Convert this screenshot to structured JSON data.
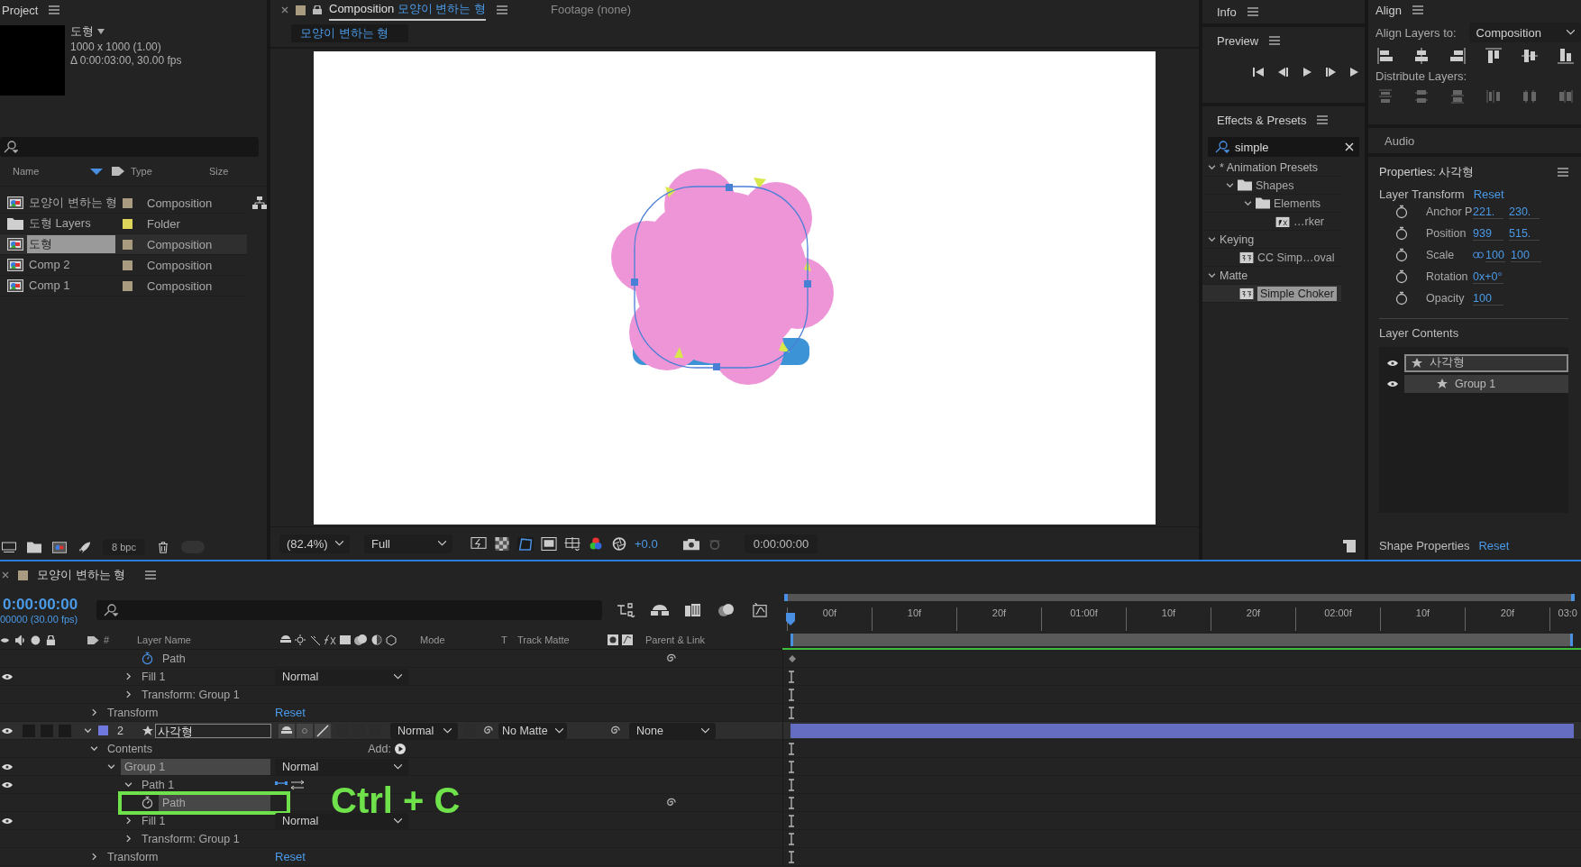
{
  "project": {
    "title": "Project",
    "preview": {
      "name": "도형",
      "details": [
        "1000 x 1000 (1.00)",
        "Δ 0:00:03:00, 30.00 fps"
      ]
    },
    "columns": [
      "Name",
      "Type",
      "Size"
    ],
    "items": [
      {
        "name": "모양이 변하는 형",
        "type": "Composition",
        "kind": "composition",
        "color": "#a99b7f",
        "selected": false
      },
      {
        "name": "도형 Layers",
        "type": "Folder",
        "kind": "folder",
        "color": "#ddd55a",
        "selected": false
      },
      {
        "name": "도형",
        "type": "Composition",
        "kind": "composition",
        "color": "#a99b7f",
        "selected": true
      },
      {
        "name": "Comp 2",
        "type": "Composition",
        "kind": "composition",
        "color": "#a99b7f",
        "selected": false
      },
      {
        "name": "Comp 1",
        "type": "Composition",
        "kind": "composition",
        "color": "#a99b7f",
        "selected": false
      }
    ],
    "bit_depth": "8 bpc",
    "toggle": {
      "on": false
    }
  },
  "composition": {
    "tabs": [
      {
        "label": "Composition",
        "name": "모양이 변하는 형",
        "selected": true
      },
      {
        "label": "Footage (none)",
        "selected": false
      }
    ],
    "viewer_tab": "모양이 변하는 형",
    "magnification": "(82.4%)",
    "resolution": "Full",
    "exposure": "+0.0",
    "timecode": "0:00:00:00"
  },
  "info": {
    "title": "Info"
  },
  "preview": {
    "title": "Preview"
  },
  "effects": {
    "title": "Effects & Presets",
    "search": "simple",
    "tree": [
      {
        "label": "* Animation Presets",
        "kind": "category",
        "expanded": true,
        "children": [
          {
            "label": "Shapes",
            "kind": "folder",
            "expanded": true,
            "children": [
              {
                "label": "Elements",
                "kind": "folder",
                "expanded": true,
                "children": [
                  {
                    "label": "…rker",
                    "kind": "preset",
                    "selected": false
                  }
                ]
              }
            ]
          }
        ]
      },
      {
        "label": "Keying",
        "kind": "category",
        "expanded": true,
        "children": [
          {
            "label": "CC Simp…oval",
            "kind": "effect",
            "selected": false
          }
        ]
      },
      {
        "label": "Matte",
        "kind": "category",
        "expanded": true,
        "children": [
          {
            "label": "Simple Choker",
            "kind": "effect",
            "selected": true
          }
        ]
      }
    ]
  },
  "align": {
    "title": "Align",
    "align_to_label": "Align Layers to:",
    "align_to": "Composition",
    "distribute_label": "Distribute Layers:"
  },
  "audio": {
    "title": "Audio"
  },
  "properties": {
    "title": "Properties: 사각형",
    "transform_title": "Layer Transform",
    "transform_reset": "Reset",
    "transform": [
      {
        "label": "Anchor P",
        "values": [
          "221.",
          "230."
        ]
      },
      {
        "label": "Position",
        "values": [
          "939",
          "515."
        ]
      },
      {
        "label": "Scale",
        "linked": true,
        "values": [
          "100",
          "100"
        ]
      },
      {
        "label": "Rotation",
        "values": [
          "0x+0°"
        ]
      },
      {
        "label": "Opacity",
        "values": [
          "100"
        ]
      }
    ],
    "contents_title": "Layer Contents",
    "contents": [
      {
        "label": "사각형",
        "selected": true,
        "children": [
          {
            "label": "Group 1",
            "selected": false
          }
        ]
      }
    ],
    "shape_title": "Shape Properties",
    "shape_reset": "Reset"
  },
  "timeline": {
    "tab": "모양이 변하는 형",
    "time": "0:00:00:00",
    "frames": "00000 (30.00 fps)",
    "columns": {
      "number": "#",
      "layer_name": "Layer Name",
      "mode": "Mode",
      "preserve": "T",
      "track_matte": "Track Matte",
      "parent": "Parent & Link"
    },
    "ruler": [
      "00f",
      "10f",
      "20f",
      "01:00f",
      "10f",
      "20f",
      "02:00f",
      "10f",
      "20f",
      "03:0"
    ],
    "annotation": "Ctrl + C",
    "rows": [
      {
        "children": [
          {
            "children": [
              {
                "children": [
                  {
                    "children": [
                      {
                        "label": "Path",
                        "kind": "property",
                        "animated": true,
                        "selected": false,
                        "highlighted": false
                      }
                    ]
                  },
                  {
                    "label": "Fill 1",
                    "kind": "group",
                    "expanded": false,
                    "visible": true,
                    "selected": false,
                    "mode": "Normal"
                  },
                  {
                    "label": "Transform: Group 1",
                    "kind": "group",
                    "expanded": false,
                    "selected": false
                  }
                ]
              }
            ]
          },
          {
            "label": "Transform",
            "kind": "group",
            "expanded": false,
            "selected": false,
            "reset": "Reset"
          }
        ]
      },
      {
        "label": "사각형",
        "kind": "layer",
        "number": "2",
        "expanded": true,
        "visible": true,
        "selected": true,
        "color": "#6f78dc",
        "mode": "Normal",
        "track_matte": "No Matte",
        "parent": "None",
        "children": [
          {
            "label": "Contents",
            "kind": "group",
            "expanded": true,
            "selected": false,
            "add": "Add:",
            "children": [
              {
                "label": "Group 1",
                "kind": "group",
                "expanded": true,
                "visible": true,
                "selected": true,
                "mode": "Normal",
                "children": [
                  {
                    "label": "Path 1",
                    "kind": "path_group",
                    "expanded": true,
                    "visible": true,
                    "selected": false,
                    "children": [
                      {
                        "label": "Path",
                        "kind": "property",
                        "animated": false,
                        "selected": true,
                        "highlighted": true
                      }
                    ]
                  },
                  {
                    "label": "Fill 1",
                    "kind": "group",
                    "expanded": false,
                    "visible": true,
                    "selected": false,
                    "mode": "Normal"
                  },
                  {
                    "label": "Transform: Group 1",
                    "kind": "group",
                    "expanded": false,
                    "selected": false
                  }
                ]
              }
            ]
          },
          {
            "label": "Transform",
            "kind": "group",
            "expanded": false,
            "selected": false,
            "reset": "Reset"
          }
        ]
      }
    ]
  }
}
